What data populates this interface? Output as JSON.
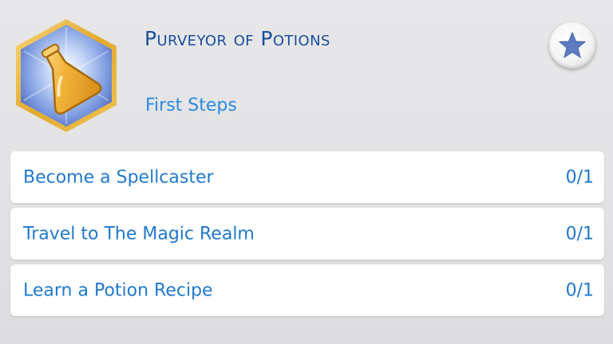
{
  "aspiration": {
    "title": "Purveyor of Potions",
    "milestone": "First Steps",
    "icon": "potion-bottle-icon"
  },
  "favorite_button": {
    "icon": "star-icon"
  },
  "objectives": [
    {
      "label": "Become a Spellcaster",
      "progress": "0/1"
    },
    {
      "label": "Travel to The Magic Realm",
      "progress": "0/1"
    },
    {
      "label": "Learn a Potion Recipe",
      "progress": "0/1"
    }
  ],
  "colors": {
    "title": "#1a4e9c",
    "milestone": "#2a8be0",
    "objective_text": "#1f78cf",
    "badge_border": "#e7b53c",
    "badge_fill": "#6f8fd4",
    "potion": "#f1b23a"
  }
}
